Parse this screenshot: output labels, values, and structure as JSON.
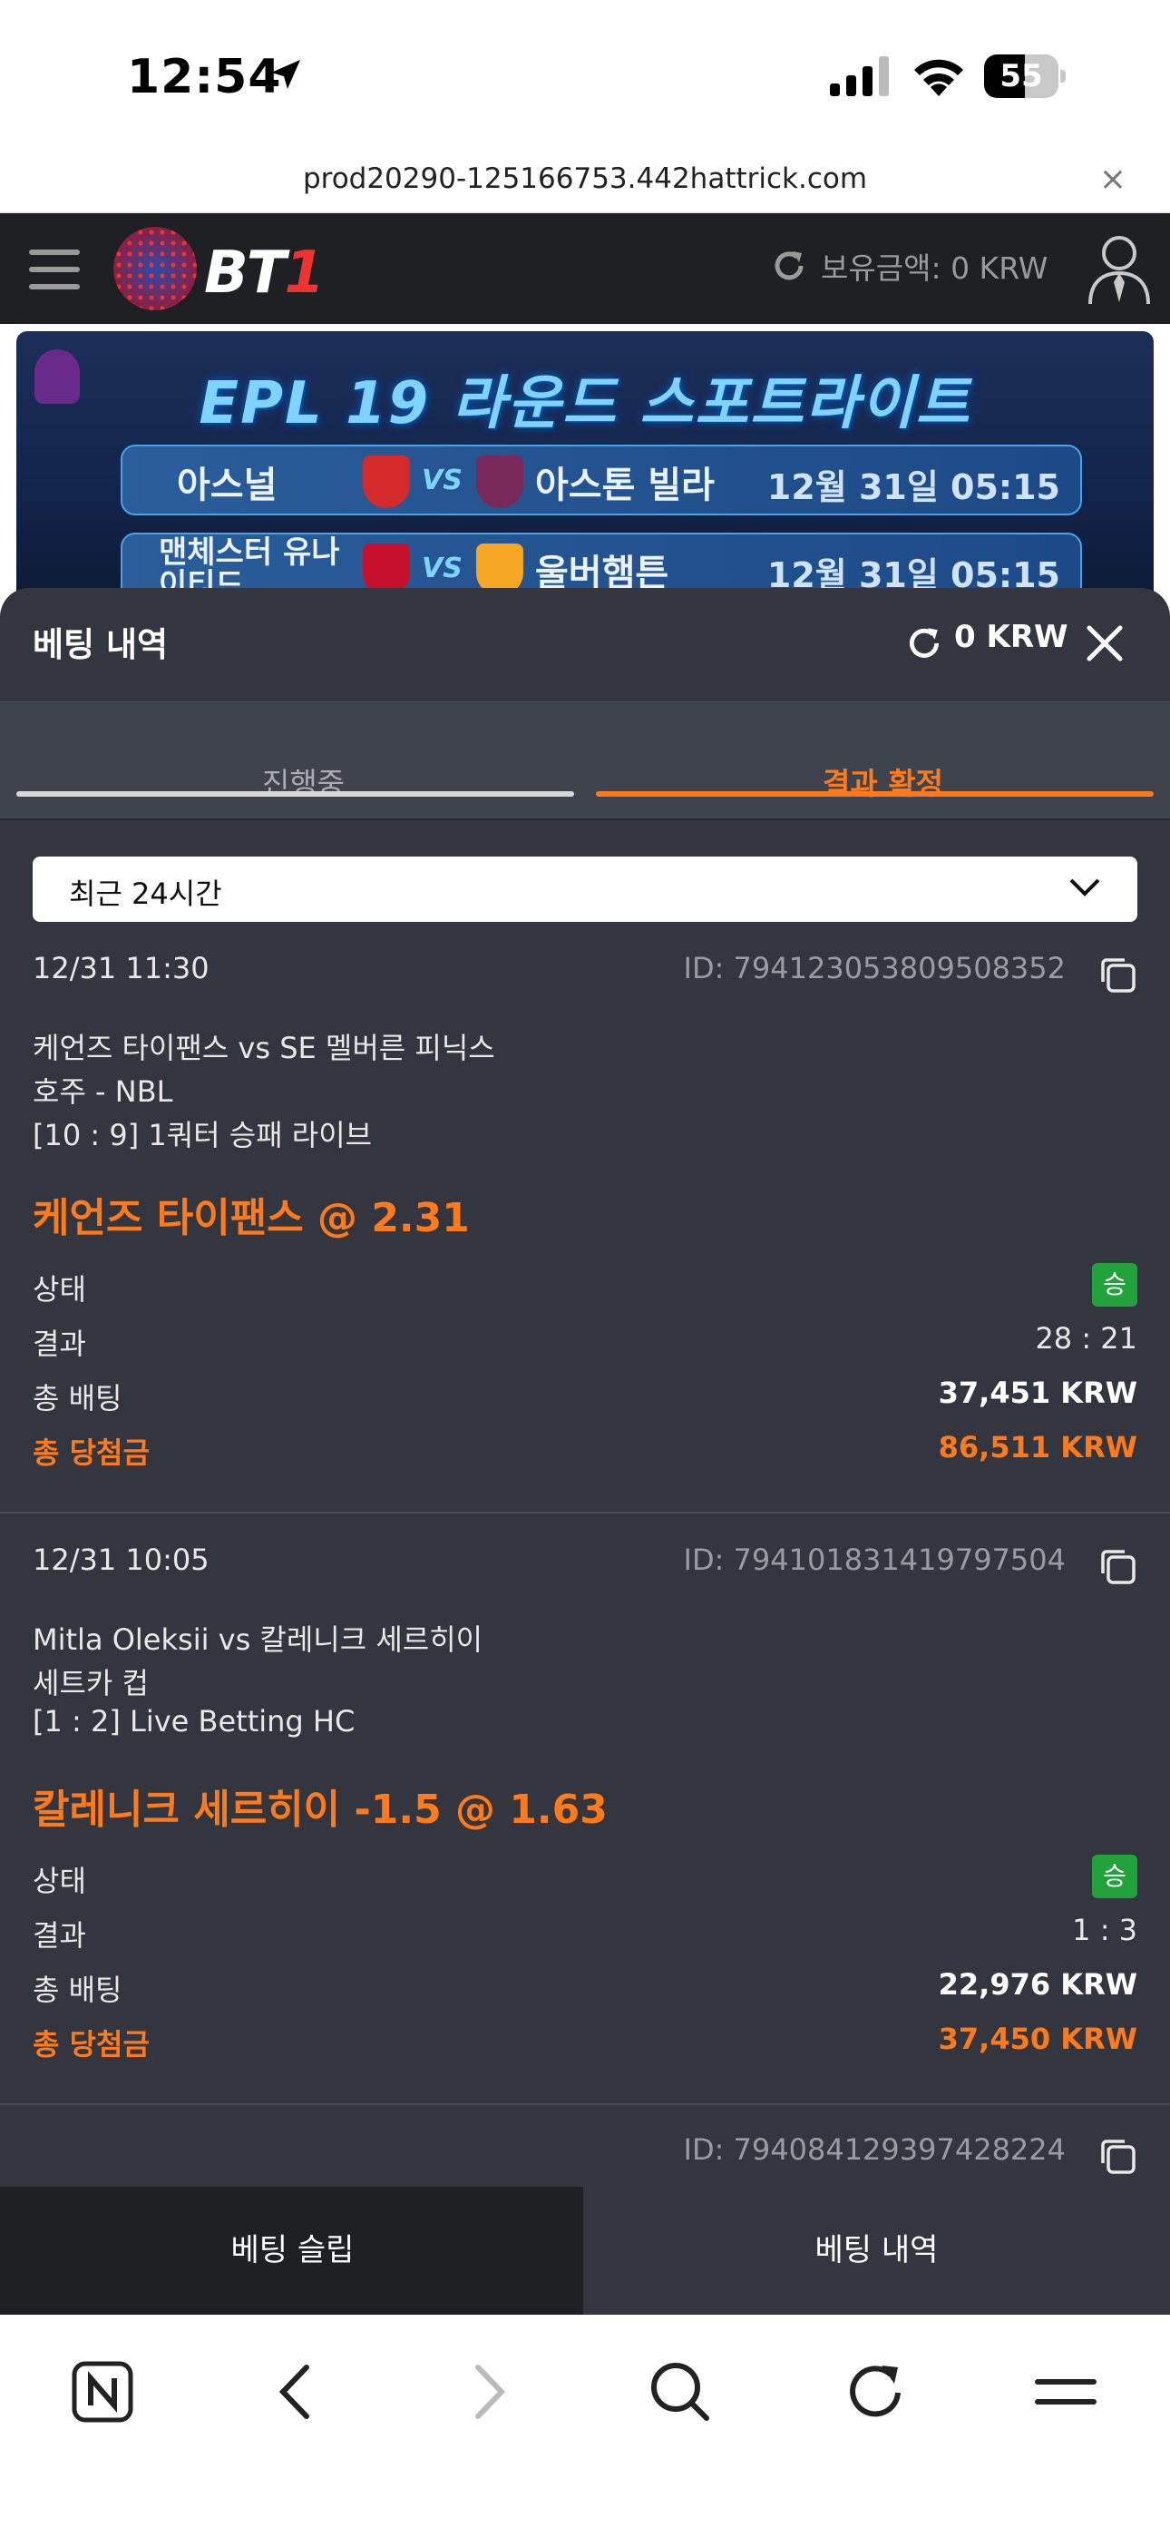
{
  "status_bar": {
    "time": "12:54",
    "battery": "55",
    "battery_level": 0.55
  },
  "url_bar": {
    "url": "prod20290-125166753.442hattrick.com",
    "close": "×"
  },
  "site_header": {
    "logo_text_a": "BT",
    "logo_text_b": "1",
    "balance_label": "보유금액:",
    "balance_value": "0 KRW"
  },
  "banner": {
    "title": "EPL 19 라운드 스포트라이트",
    "matches": [
      {
        "home": "아스널",
        "vs": "VS",
        "away": "아스톤 빌라",
        "time": "12월 31일 05:15",
        "home_color": "#d42a2a",
        "away_color": "#7a2a5a"
      },
      {
        "home": "맨체스터 유나이티드",
        "vs": "VS",
        "away": "울버햄튼",
        "time": "12월 31일 05:15",
        "home_color": "#c8102e",
        "away_color": "#f5a623"
      }
    ]
  },
  "sheet": {
    "title": "베팅 내역",
    "balance": "0 KRW",
    "tabs": [
      {
        "label": "진행중",
        "active": false
      },
      {
        "label": "결과 확정",
        "active": true
      }
    ],
    "filter": {
      "selected": "최근 24시간"
    },
    "bets": [
      {
        "date": "12/31 11:30",
        "id": "ID: 794123053809508352",
        "match": "케언즈 타이팬스 vs SE 멜버른 피닉스",
        "league": "호주 - NBL",
        "market": "[10 : 9] 1쿼터 승패 라이브",
        "pick": "케언즈 타이팬스 @ 2.31",
        "status_label": "상태",
        "status_value": "승",
        "result_label": "결과",
        "result_value": "28 : 21",
        "stake_label": "총 배팅",
        "stake_value": "37,451 KRW",
        "win_label": "총 당첨금",
        "win_value": "86,511 KRW"
      },
      {
        "date": "12/31 10:05",
        "id": "ID: 794101831419797504",
        "match": "Mitla Oleksii vs 칼레니크 세르히이",
        "league": "세트카 컵",
        "market": "[1 : 2] Live Betting HC",
        "pick": "칼레니크 세르히이 -1.5 @ 1.63",
        "status_label": "상태",
        "status_value": "승",
        "result_label": "결과",
        "result_value": "1 : 3",
        "stake_label": "총 배팅",
        "stake_value": "22,976 KRW",
        "win_label": "총 당첨금",
        "win_value": "37,450 KRW"
      },
      {
        "id": "ID: 794084129397428224"
      }
    ]
  },
  "bottom_tabs": {
    "slip": "베팅 슬립",
    "history": "베팅 내역"
  },
  "colors": {
    "accent": "#ff7a1a",
    "win": "#22a23a",
    "sheet_bg": "#33363e",
    "header_bg": "#1e2024"
  },
  "toolbar_icons": [
    "naver-icon",
    "back-icon",
    "forward-icon",
    "search-icon",
    "reload-icon",
    "menu-icon"
  ]
}
